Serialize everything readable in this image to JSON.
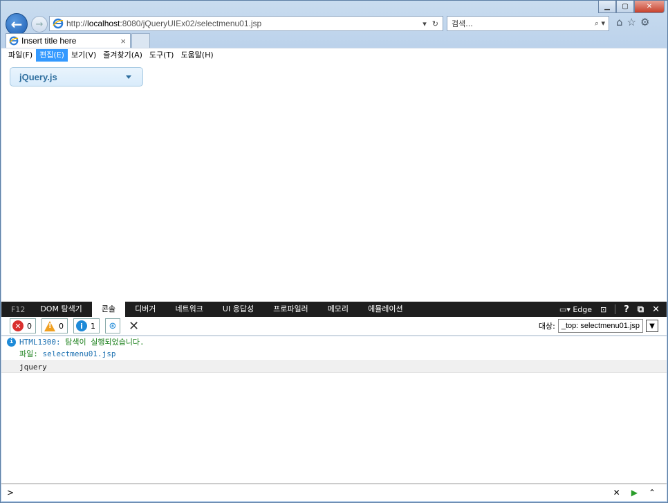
{
  "browser": {
    "url_prefix": "http://",
    "url_host": "localhost",
    "url_rest": ":8080/jQueryUIEx02/selectmenu01.jsp",
    "search_placeholder": "검색...",
    "tab_title": "Insert title here",
    "menu": [
      "파일(F)",
      "편집(E)",
      "보기(V)",
      "즐겨찾기(A)",
      "도구(T)",
      "도움말(H)"
    ]
  },
  "page": {
    "selectmenu_value": "jQuery.js"
  },
  "devtools": {
    "f12": "F12",
    "tabs": [
      "DOM 탐색기",
      "콘솔",
      "디버거",
      "네트워크",
      "UI 응답성",
      "프로파일러",
      "메모리",
      "에뮬레이션"
    ],
    "mode": "Edge",
    "errors": "0",
    "warnings": "0",
    "infos": "1",
    "target_label": "대상:",
    "target_value": "_top: selectmenu01.jsp",
    "message_code": "HTML1300:",
    "message_text": "탐색이 실행되었습니다.",
    "message_file_label": "파일:",
    "message_file": "selectmenu01.jsp",
    "log_line": "jquery",
    "prompt": ">"
  },
  "colors": {
    "accent": "#3399ff",
    "selectmenu_text": "#2e6e9e"
  }
}
